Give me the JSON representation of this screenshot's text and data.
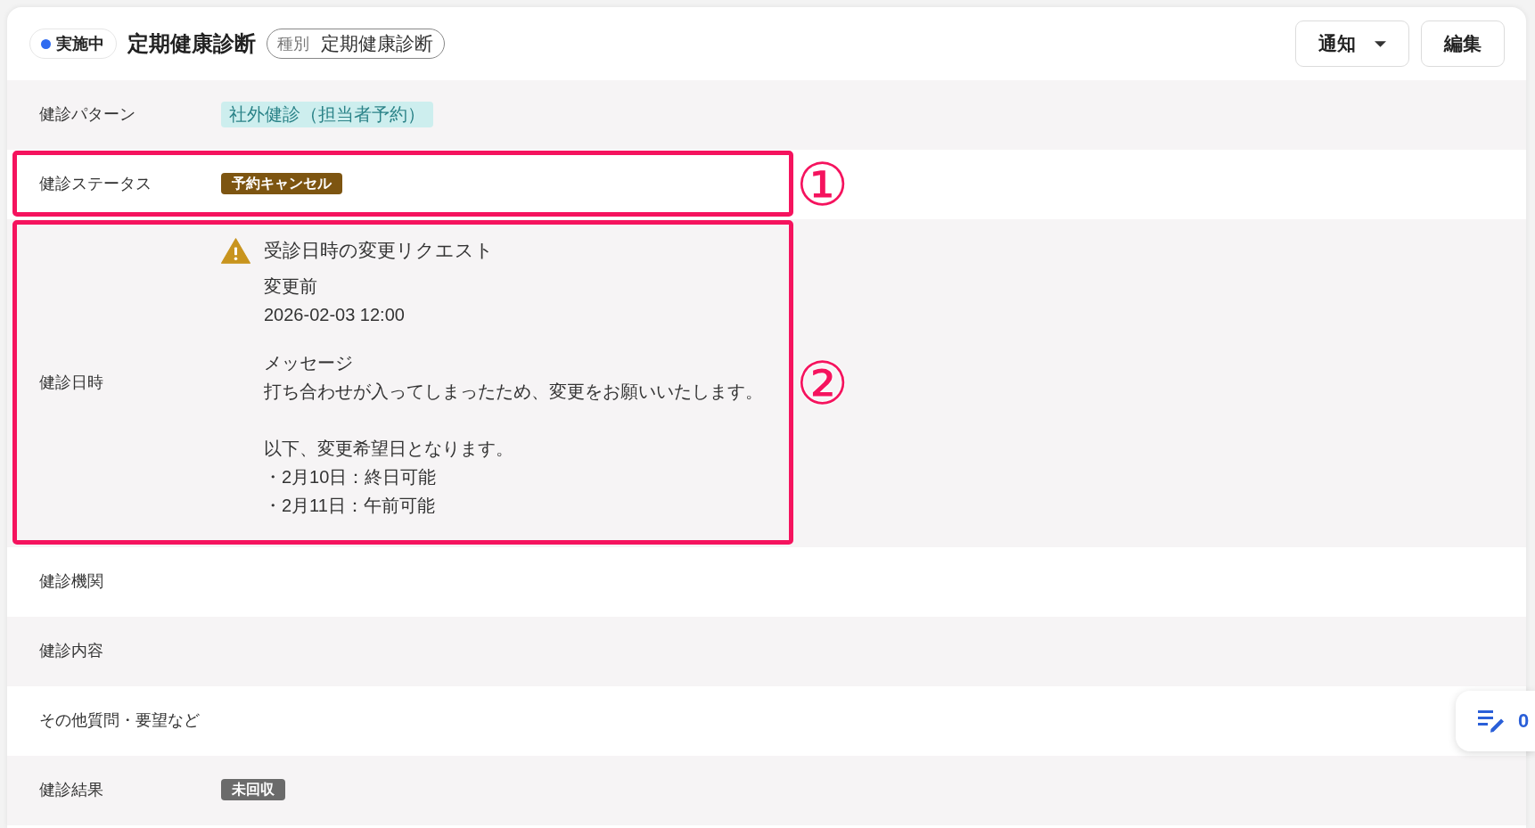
{
  "header": {
    "status": {
      "label": "実施中"
    },
    "title": "定期健康診断",
    "type": {
      "label": "種別",
      "value": "定期健康診断"
    },
    "buttons": [
      {
        "label": "通知",
        "kind": "dropdown"
      },
      {
        "label": "編集",
        "kind": "plain"
      }
    ]
  },
  "fields": [
    {
      "label": "健診パターン",
      "kind": "tag",
      "value": "社外健診（担当者予約）"
    },
    {
      "label": "健診ステータス",
      "kind": "badge",
      "value": "予約キャンセル",
      "color": "#7d5511",
      "annotation": "①"
    },
    {
      "label": "健診日時",
      "kind": "change_request",
      "annotation": "②",
      "request": {
        "title": "受診日時の変更リクエスト",
        "before_label": "変更前",
        "before_value": "2026-02-03 12:00",
        "message_label": "メッセージ",
        "message": [
          {
            "lines": [
              "打ち合わせが入ってしまったため、変更をお願いいたします。"
            ]
          },
          {
            "lines": [
              "以下、変更希望日となります。",
              "・2月10日：終日可能",
              "・2月11日：午前可能"
            ]
          }
        ]
      }
    },
    {
      "label": "健診機関",
      "kind": "empty"
    },
    {
      "label": "健診内容",
      "kind": "empty"
    },
    {
      "label": "その他質問・要望など",
      "kind": "empty"
    },
    {
      "label": "健診結果",
      "kind": "badge",
      "value": "未回収",
      "color": "#6b6b6b"
    }
  ],
  "memo_button": {
    "count": "0"
  }
}
